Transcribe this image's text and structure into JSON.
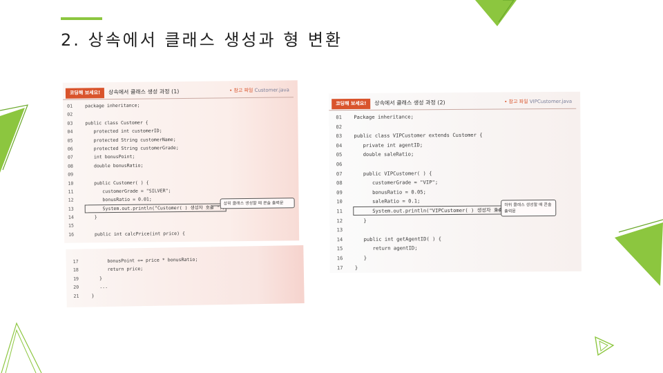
{
  "slide": {
    "title": "2. 상속에서 클래스 생성과 형 변환"
  },
  "cards": [
    {
      "badge": "코딩해 보세요!",
      "heading": "상속에서 클래스 생성 과정 (1)",
      "ref_prefix": "• 참고 파일",
      "ref_file": "Customer.java",
      "callout": "상위 클래스 생성할 때 콘솔 출력문",
      "lines": [
        {
          "n": "01",
          "t": "package inheritance;"
        },
        {
          "n": "02",
          "t": ""
        },
        {
          "n": "03",
          "t": "public class Customer {"
        },
        {
          "n": "04",
          "t": "   protected int customerID;"
        },
        {
          "n": "05",
          "t": "   protected String customerName;"
        },
        {
          "n": "06",
          "t": "   protected String customerGrade;"
        },
        {
          "n": "07",
          "t": "   int bonusPoint;"
        },
        {
          "n": "08",
          "t": "   double bonusRatio;"
        },
        {
          "n": "09",
          "t": ""
        },
        {
          "n": "10",
          "t": "   public Customer( ) {"
        },
        {
          "n": "11",
          "t": "      customerGrade = \"SILVER\";"
        },
        {
          "n": "12",
          "t": "      bonusRatio = 0.01;"
        },
        {
          "n": "13",
          "t": "      System.out.println(\"Customer( ) 생성자 호출 \");"
        },
        {
          "n": "14",
          "t": "   }"
        },
        {
          "n": "15",
          "t": ""
        },
        {
          "n": "16",
          "t": "   public int calcPrice(int price) {"
        }
      ],
      "lines_continued": [
        {
          "n": "17",
          "t": "      bonusPoint += price * bonusRatio;"
        },
        {
          "n": "18",
          "t": "      return price;"
        },
        {
          "n": "19",
          "t": "   }"
        },
        {
          "n": "20",
          "t": "   ..."
        },
        {
          "n": "21",
          "t": "}"
        }
      ]
    },
    {
      "badge": "코딩해 보세요!",
      "heading": "상속에서 클래스 생성 과정 (2)",
      "ref_prefix": "• 참고 파일",
      "ref_file": "VIPCustomer.java",
      "callout": "하위 클래스 생성할 때 콘솔 출력문",
      "lines": [
        {
          "n": "01",
          "t": "Package inheritance;"
        },
        {
          "n": "02",
          "t": ""
        },
        {
          "n": "03",
          "t": "public class VIPCustomer extends Customer {"
        },
        {
          "n": "04",
          "t": "   private int agentID;"
        },
        {
          "n": "05",
          "t": "   double saleRatio;"
        },
        {
          "n": "06",
          "t": ""
        },
        {
          "n": "07",
          "t": "   public VIPCustomer( ) {"
        },
        {
          "n": "08",
          "t": "      customerGrade = \"VIP\";"
        },
        {
          "n": "09",
          "t": "      bonusRatio = 0.05;"
        },
        {
          "n": "10",
          "t": "      saleRatio = 0.1;"
        },
        {
          "n": "11",
          "t": "      System.out.println(\"VIPCustomer( ) 생성자 호출 \");"
        },
        {
          "n": "12",
          "t": "   }"
        },
        {
          "n": "13",
          "t": ""
        },
        {
          "n": "14",
          "t": "   public int getAgentID( ) {"
        },
        {
          "n": "15",
          "t": "      return agentID;"
        },
        {
          "n": "16",
          "t": "   }"
        },
        {
          "n": "17",
          "t": "}"
        }
      ]
    }
  ],
  "colors": {
    "accent": "#8cc63f",
    "accent_dark": "#6aa82b",
    "badge": "#d9542c"
  }
}
